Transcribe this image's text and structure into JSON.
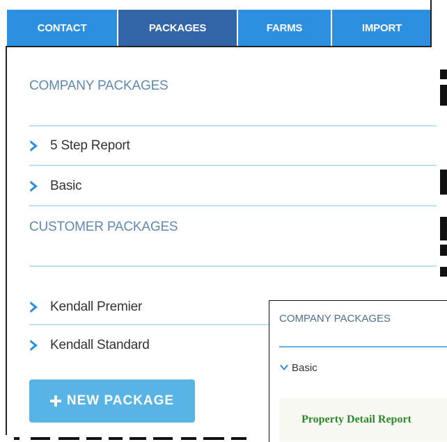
{
  "tabs": [
    {
      "label": "CONTACT",
      "active": false
    },
    {
      "label": "PACKAGES",
      "active": true
    },
    {
      "label": "FARMS",
      "active": false
    },
    {
      "label": "IMPORT",
      "active": false
    }
  ],
  "company_packages": {
    "title": "COMPANY PACKAGES",
    "items": [
      {
        "label": "5 Step Report"
      },
      {
        "label": "Basic"
      }
    ]
  },
  "customer_packages": {
    "title": "CUSTOMER PACKAGES",
    "items": [
      {
        "label": "Kendall Premier"
      },
      {
        "label": "Kendall Standard"
      }
    ]
  },
  "new_package_button": {
    "label": "NEW PACKAGE"
  },
  "overlay": {
    "title": "COMPANY PACKAGES",
    "expanded_item": {
      "label": "Basic"
    },
    "report": {
      "label": "Property Detail Report"
    }
  },
  "colors": {
    "tab": "#2d8fe0",
    "tab_active": "#3366a8",
    "section_title": "#5f89b0",
    "chevron": "#2d8fe0",
    "button": "#59b4e6",
    "report_text": "#2c8a2c"
  },
  "icons": {
    "collapsed": "chevron-right-icon",
    "expanded": "chevron-down-icon",
    "add": "plus-icon"
  }
}
